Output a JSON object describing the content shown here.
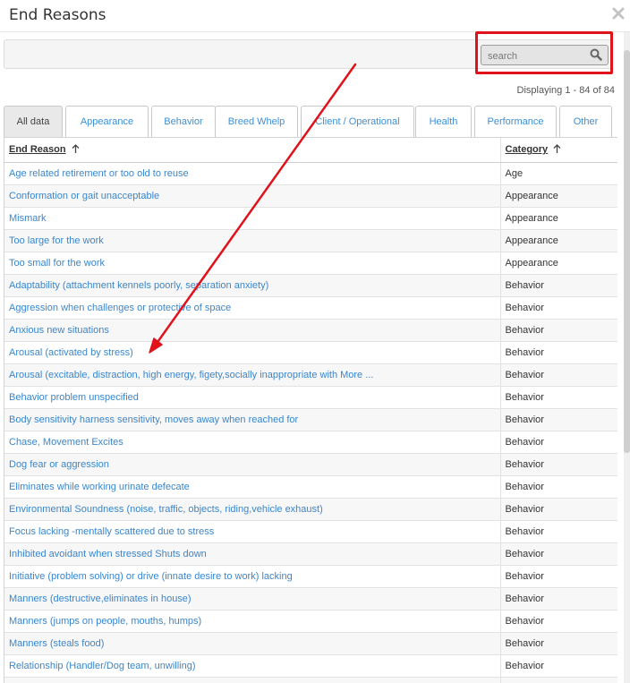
{
  "dialog": {
    "title": "End Reasons"
  },
  "icons": {
    "close": "close-icon",
    "search": "search-icon",
    "sort": "sort-arrow-up-icon"
  },
  "colors": {
    "link": "#3a86cc",
    "highlight": "#e0121c",
    "active_tab": "#e9e9e9"
  },
  "search": {
    "placeholder": "search",
    "value": ""
  },
  "paging": {
    "text": "Displaying 1 - 84 of 84"
  },
  "tabs": [
    {
      "label": "All data",
      "active": true
    },
    {
      "label": "Appearance"
    },
    {
      "label": "Behavior"
    },
    {
      "label": "Breed Whelp"
    },
    {
      "label": "Client / Operational"
    },
    {
      "label": "Health"
    },
    {
      "label": "Performance"
    },
    {
      "label": "Other"
    }
  ],
  "grid": {
    "columns": [
      "End Reason",
      "Category"
    ],
    "rows": [
      {
        "reason": "Age related retirement or too old to reuse",
        "category": "Age"
      },
      {
        "reason": "Conformation or gait unacceptable",
        "category": "Appearance"
      },
      {
        "reason": "Mismark",
        "category": "Appearance"
      },
      {
        "reason": "Too large for the work",
        "category": "Appearance"
      },
      {
        "reason": "Too small for the work",
        "category": "Appearance"
      },
      {
        "reason": "Adaptability (attachment kennels poorly, separation anxiety)",
        "category": "Behavior"
      },
      {
        "reason": "Aggression when challenges or protective of space",
        "category": "Behavior"
      },
      {
        "reason": "Anxious new situations",
        "category": "Behavior"
      },
      {
        "reason": "Arousal (activated by stress)",
        "category": "Behavior"
      },
      {
        "reason": "Arousal (excitable, distraction, high energy, figety,socially inappropriate with More ...",
        "category": "Behavior"
      },
      {
        "reason": "Behavior problem unspecified",
        "category": "Behavior"
      },
      {
        "reason": "Body sensitivity harness sensitivity, moves away when reached for",
        "category": "Behavior"
      },
      {
        "reason": "Chase, Movement Excites",
        "category": "Behavior"
      },
      {
        "reason": "Dog fear or aggression",
        "category": "Behavior"
      },
      {
        "reason": "Eliminates while working urinate defecate",
        "category": "Behavior"
      },
      {
        "reason": "Environmental Soundness (noise, traffic, objects, riding,vehicle exhaust)",
        "category": "Behavior"
      },
      {
        "reason": "Focus lacking -mentally scattered due to stress",
        "category": "Behavior"
      },
      {
        "reason": "Inhibited avoidant when stressed Shuts down",
        "category": "Behavior"
      },
      {
        "reason": "Initiative (problem solving) or drive (innate desire to work) lacking",
        "category": "Behavior"
      },
      {
        "reason": "Manners (destructive,eliminates in house)",
        "category": "Behavior"
      },
      {
        "reason": "Manners (jumps on people, mouths, humps)",
        "category": "Behavior"
      },
      {
        "reason": "Manners (steals food)",
        "category": "Behavior"
      },
      {
        "reason": "Relationship (Handler/Dog team, unwilling)",
        "category": "Behavior"
      },
      {
        "reason": "",
        "category": ""
      }
    ]
  }
}
